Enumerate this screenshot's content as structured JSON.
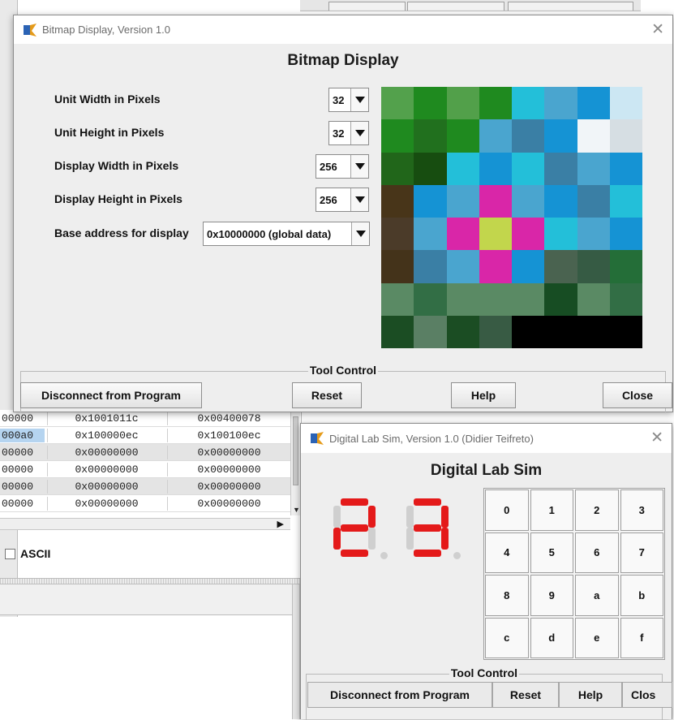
{
  "bitmap_window": {
    "title": "Bitmap Display, Version 1.0",
    "heading": "Bitmap Display",
    "settings": [
      {
        "label": "Unit Width in Pixels",
        "value": "32"
      },
      {
        "label": "Unit Height in Pixels",
        "value": "32"
      },
      {
        "label": "Display Width in Pixels",
        "value": "256"
      },
      {
        "label": "Display Height in Pixels",
        "value": "256"
      },
      {
        "label": "Base address for display",
        "value": "0x10000000 (global data)"
      }
    ],
    "pixel_grid": [
      [
        "#53a14c",
        "#1f8a1f",
        "#52a04a",
        "#1f8a1f",
        "#23bfd9",
        "#4aa5cf",
        "#1593d4",
        "#cce7f3"
      ],
      [
        "#1f8a1f",
        "#21701e",
        "#1f8a1f",
        "#4aa5cf",
        "#3a7fa5",
        "#1593d4",
        "#f1f5f8",
        "#d6dee3"
      ],
      [
        "#21661a",
        "#174d10",
        "#23bfd9",
        "#1593d4",
        "#23bfd9",
        "#3a7fa5",
        "#4aa5cf",
        "#1593d4"
      ],
      [
        "#483519",
        "#1593d4",
        "#4aa5cf",
        "#d926a8",
        "#4aa5cf",
        "#1593d4",
        "#3a7fa5",
        "#23bfd9"
      ],
      [
        "#4b3b29",
        "#4aa5cf",
        "#d926a8",
        "#c2d64c",
        "#d926a8",
        "#23bfd9",
        "#4aa5cf",
        "#1593d4"
      ],
      [
        "#44331a",
        "#3a7fa5",
        "#4aa5cf",
        "#d926a8",
        "#1593d4",
        "#4a6350",
        "#365b44",
        "#246e38"
      ],
      [
        "#5a8a64",
        "#326e45",
        "#5a8a64",
        "#5a8a64",
        "#5a8a64",
        "#174d23",
        "#5a8a64",
        "#326e45"
      ],
      [
        "#1b4d23",
        "#5a7f64",
        "#1b4d23",
        "#385b44",
        "#000000",
        "#000000",
        "#000000",
        "#000000"
      ]
    ],
    "tool_control_label": "Tool Control",
    "buttons": {
      "disconnect": "Disconnect from Program",
      "reset": "Reset",
      "help": "Help",
      "close": "Close"
    }
  },
  "dls_window": {
    "title": "Digital Lab Sim,  Version 1.0 (Didier Teifreto)",
    "heading": "Digital Lab Sim",
    "display_digits": [
      "2",
      "3"
    ],
    "keypad": [
      "0",
      "1",
      "2",
      "3",
      "4",
      "5",
      "6",
      "7",
      "8",
      "9",
      "a",
      "b",
      "c",
      "d",
      "e",
      "f"
    ],
    "tool_control_label": "Tool Control",
    "buttons": {
      "disconnect": "Disconnect from Program",
      "reset": "Reset",
      "help": "Help",
      "close": "Clos"
    }
  },
  "background": {
    "table_rows": [
      [
        "00000",
        "0x1001011c",
        "0x00400078"
      ],
      [
        "000a0",
        "0x100000ec",
        "0x100100ec"
      ],
      [
        "00000",
        "0x00000000",
        "0x00000000"
      ],
      [
        "00000",
        "0x00000000",
        "0x00000000"
      ],
      [
        "00000",
        "0x00000000",
        "0x00000000"
      ],
      [
        "00000",
        "0x00000000",
        "0x00000000"
      ]
    ],
    "ascii_label": "ASCII"
  },
  "colors": {
    "segment_on": "#e41a1a",
    "segment_off": "#cfcfcf",
    "window_bg": "#eeeeee"
  }
}
